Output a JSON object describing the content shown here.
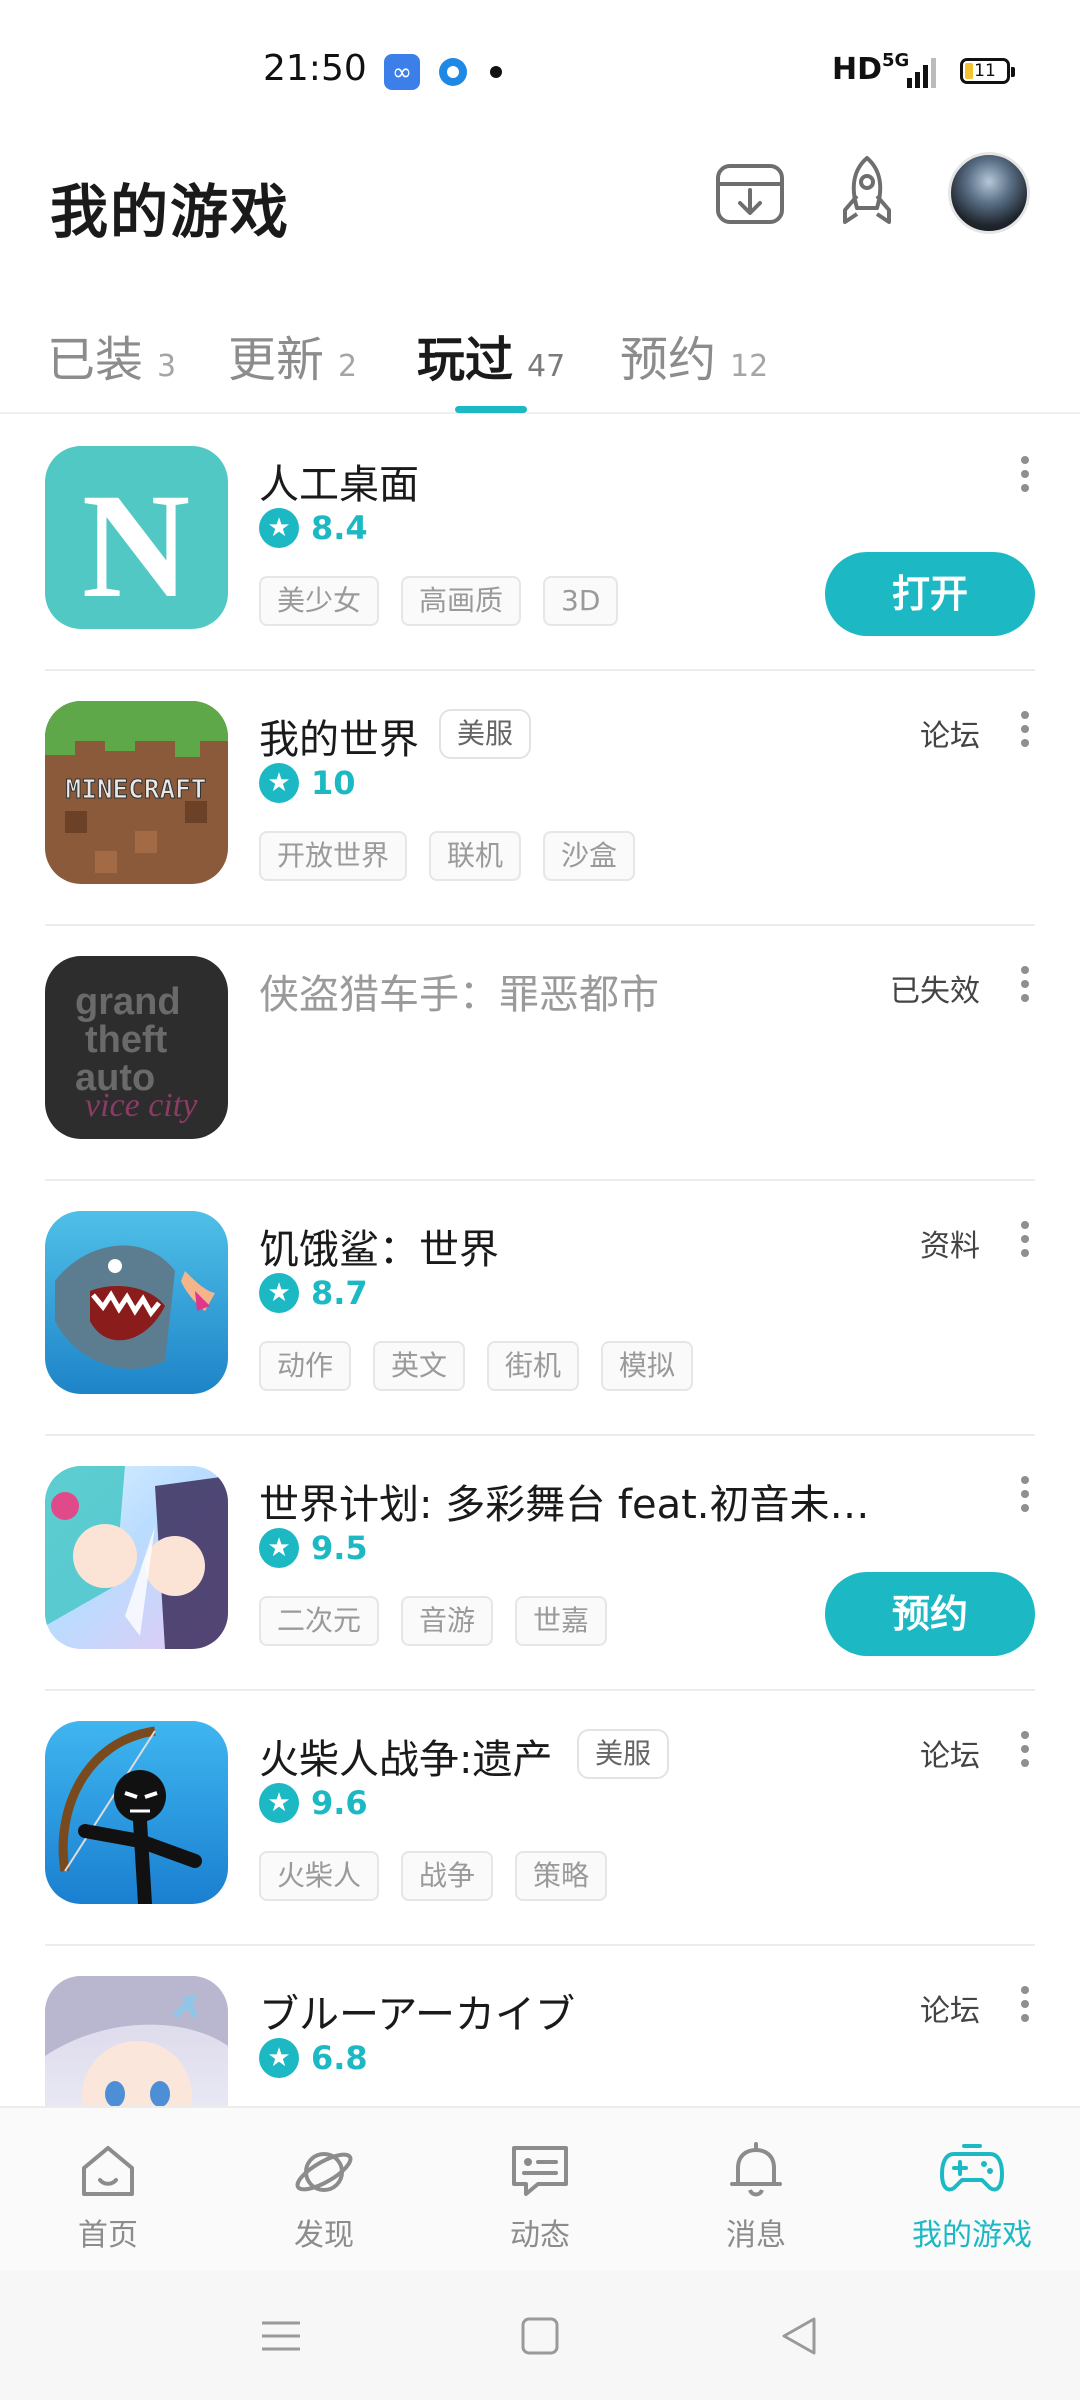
{
  "status_bar": {
    "time": "21:50",
    "hd": "HD",
    "network": "5G",
    "battery": "11"
  },
  "header": {
    "title": "我的游戏"
  },
  "tabs": [
    {
      "label": "已装",
      "count": "3"
    },
    {
      "label": "更新",
      "count": "2"
    },
    {
      "label": "玩过",
      "count": "47",
      "active": true
    },
    {
      "label": "预约",
      "count": "12"
    }
  ],
  "games": [
    {
      "name": "人工桌面",
      "icon": "n-letter-icon",
      "rating": "8.4",
      "tags": [
        "美少女",
        "高画质",
        "3D"
      ],
      "action": "打开"
    },
    {
      "name": "我的世界",
      "badge": "美服",
      "icon": "minecraft-icon",
      "rating": "10",
      "tags": [
        "开放世界",
        "联机",
        "沙盒"
      ],
      "link": "论坛"
    },
    {
      "name": "侠盗猎车手：罪恶都市",
      "icon": "gta-vice-city-icon",
      "link": "已失效"
    },
    {
      "name": "饥饿鲨：世界",
      "icon": "shark-icon",
      "rating": "8.7",
      "tags": [
        "动作",
        "英文",
        "街机",
        "模拟"
      ],
      "link": "资料"
    },
    {
      "name": "世界计划: 多彩舞台 feat.初音未…",
      "icon": "anime-girls-icon",
      "rating": "9.5",
      "tags": [
        "二次元",
        "音游",
        "世嘉"
      ],
      "action": "预约"
    },
    {
      "name": "火柴人战争:遗产",
      "badge": "美服",
      "icon": "stickman-archer-icon",
      "rating": "9.6",
      "tags": [
        "火柴人",
        "战争",
        "策略"
      ],
      "link": "论坛"
    },
    {
      "name": "ブルーアーカイブ",
      "icon": "blue-archive-girl-icon",
      "rating": "6.8",
      "link": "论坛"
    }
  ],
  "bottom_nav": [
    {
      "label": "首页",
      "icon": "home-icon"
    },
    {
      "label": "发现",
      "icon": "planet-icon"
    },
    {
      "label": "动态",
      "icon": "chat-card-icon"
    },
    {
      "label": "消息",
      "icon": "bell-icon"
    },
    {
      "label": "我的游戏",
      "icon": "gamepad-icon",
      "active": true
    }
  ],
  "colors": {
    "accent": "#1cb9c4",
    "text": "#1a1a1a",
    "muted": "#8c8c8c"
  }
}
